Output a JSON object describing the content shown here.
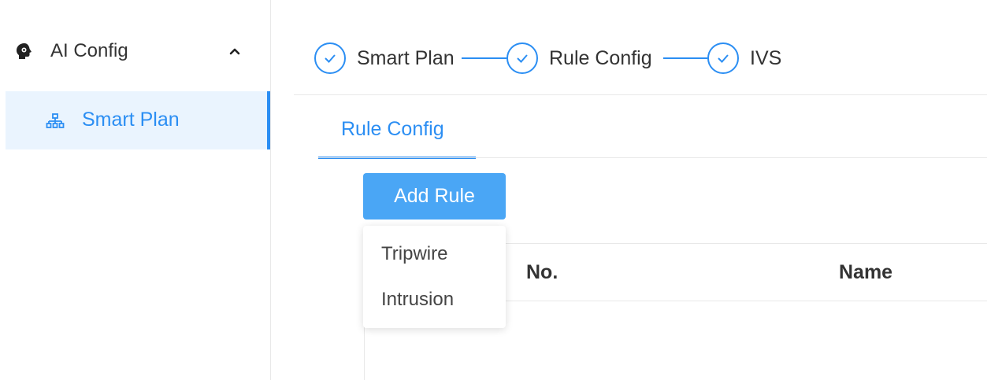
{
  "sidebar": {
    "group": {
      "label": "AI Config",
      "icon": "ai-head-icon",
      "expanded": true
    },
    "items": [
      {
        "label": "Smart Plan",
        "icon": "org-chart-icon",
        "active": true
      }
    ]
  },
  "steps": [
    {
      "label": "Smart Plan",
      "state": "done"
    },
    {
      "label": "Rule Config",
      "state": "done"
    },
    {
      "label": "IVS",
      "state": "done"
    }
  ],
  "tabs": [
    {
      "label": "Rule Config",
      "active": true
    }
  ],
  "add_rule": {
    "label": "Add Rule",
    "menu": [
      "Tripwire",
      "Intrusion"
    ]
  },
  "table": {
    "columns": [
      "No.",
      "Name"
    ]
  },
  "colors": {
    "accent": "#2b8ef3",
    "button": "#4aa6f5",
    "active_bg": "#eaf4fe"
  }
}
